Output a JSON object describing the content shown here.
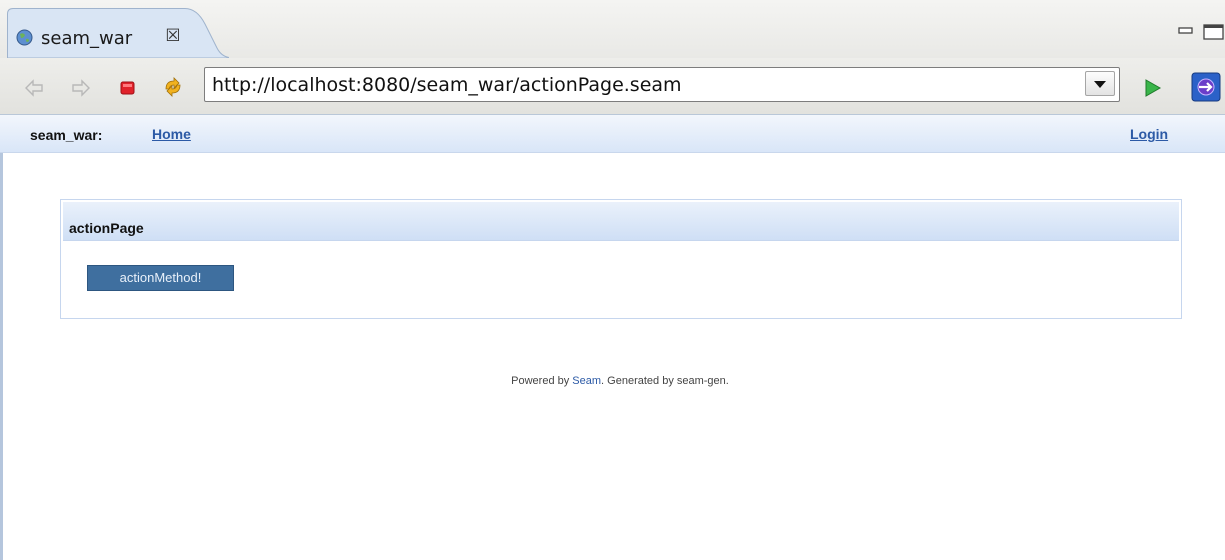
{
  "tab": {
    "title": "seam_war",
    "close_glyph": "☒",
    "icon": "globe-icon"
  },
  "toolbar": {
    "back_icon": "back-arrow-icon",
    "forward_icon": "forward-arrow-icon",
    "stop_icon": "stop-icon",
    "refresh_icon": "refresh-icon",
    "url": "http://localhost:8080/seam_war/actionPage.seam",
    "go_icon": "go-icon",
    "external_icon": "open-external-browser-icon"
  },
  "menu": {
    "app_name": "seam_war:",
    "home": "Home",
    "login": "Login"
  },
  "panel": {
    "title": "actionPage",
    "button": "actionMethod!"
  },
  "footer": {
    "prefix": "Powered by ",
    "link": "Seam",
    "suffix": ". Generated by seam-gen."
  },
  "colors": {
    "link": "#2c5aa6",
    "button": "#3f6f9f",
    "go_green": "#2ea043",
    "stop_red": "#d11"
  }
}
